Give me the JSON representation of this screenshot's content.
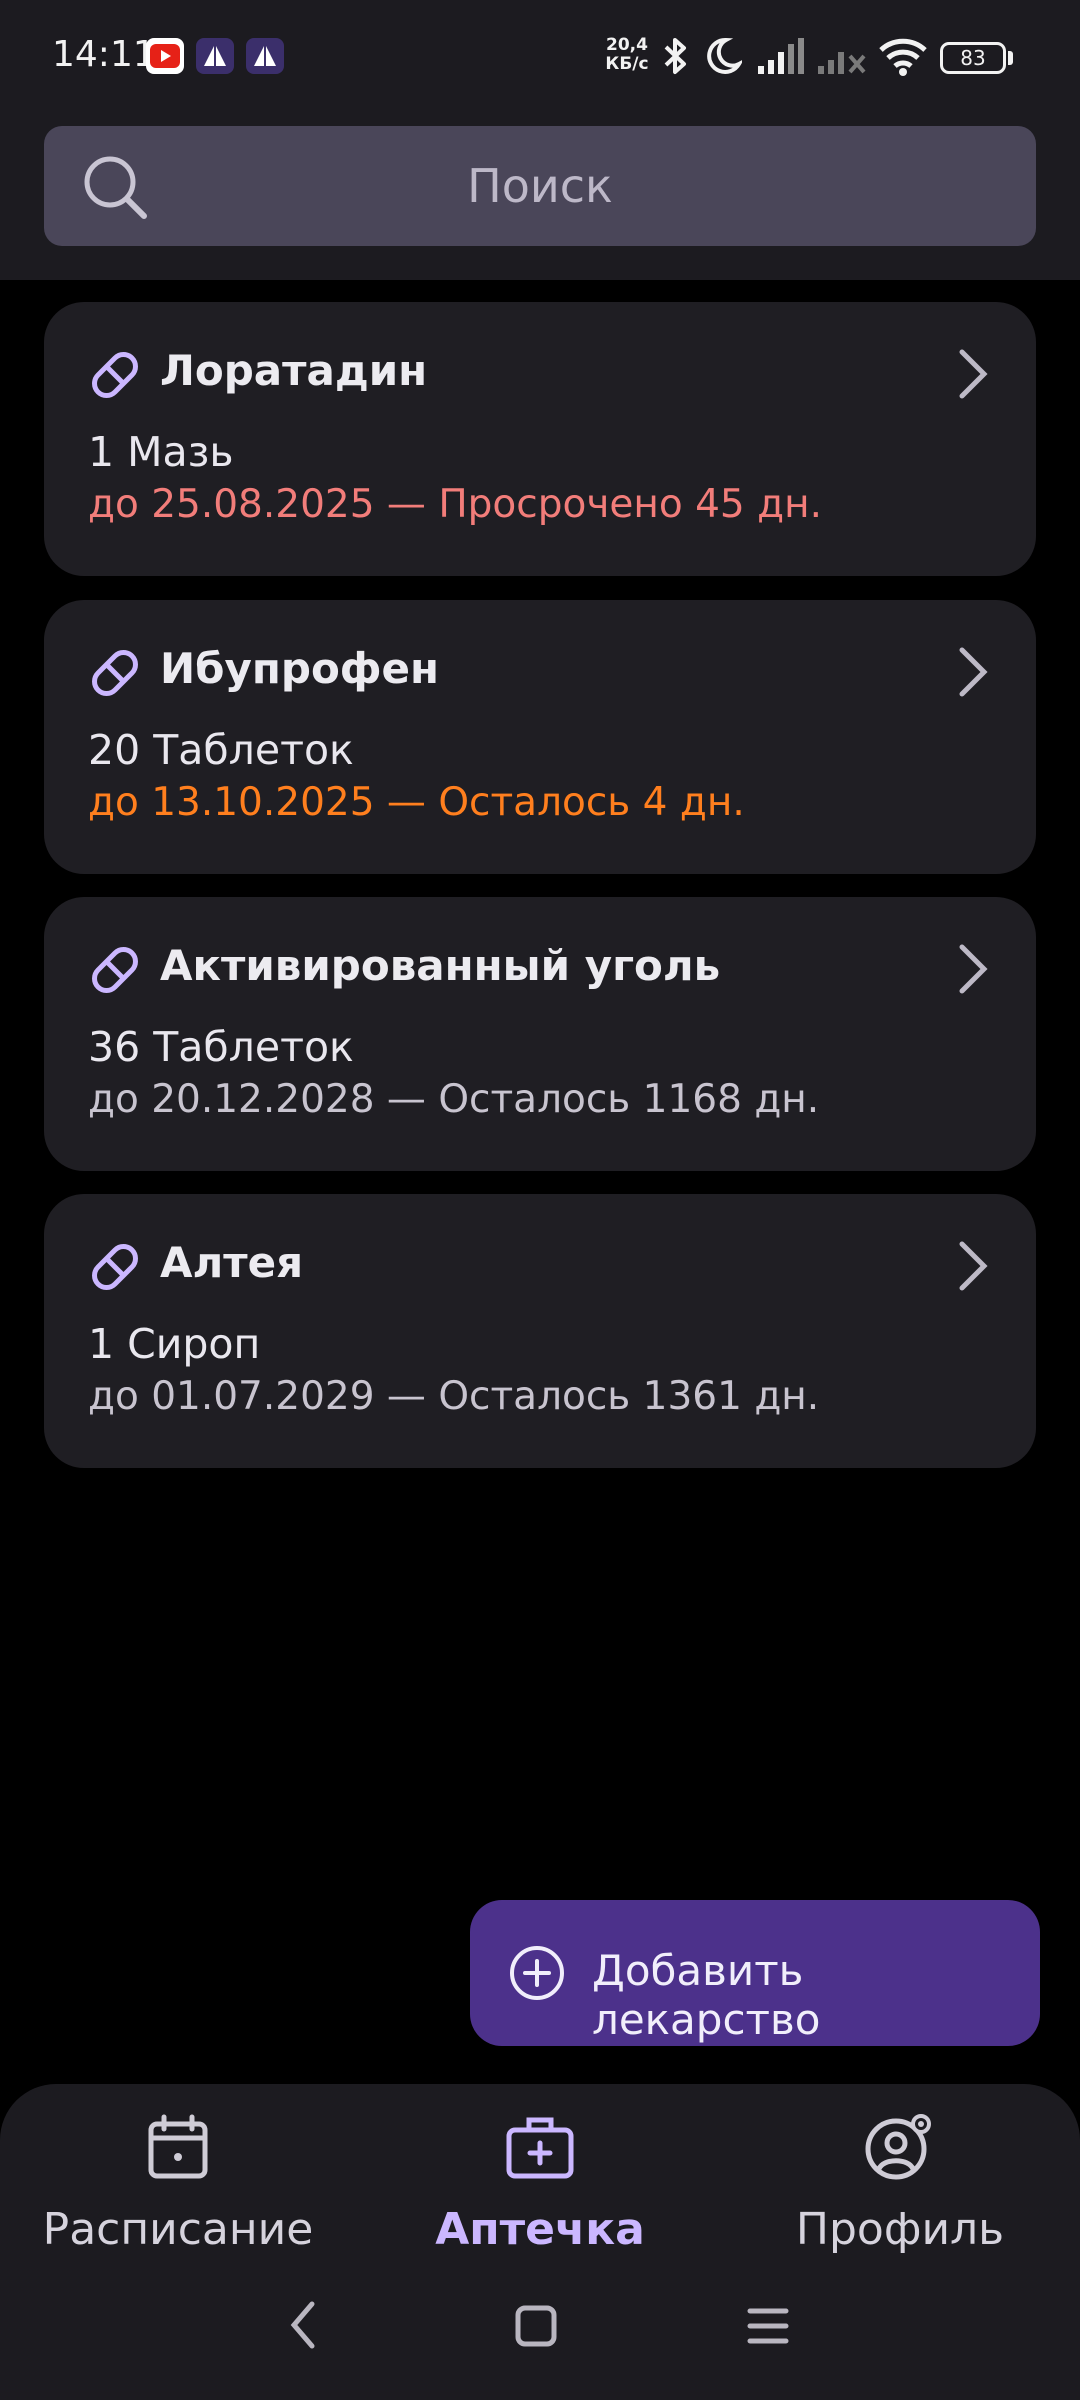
{
  "status_bar": {
    "time": "14:11",
    "net_speed_value": "20,4",
    "net_speed_unit": "КБ/с",
    "battery": "83"
  },
  "search": {
    "placeholder": "Поиск"
  },
  "medicines": [
    {
      "name": "Лоратадин",
      "quantity": "1 Мазь",
      "expiry": "до 25.08.2025 — Просрочено 45 дн.",
      "status": "expired"
    },
    {
      "name": "Ибупрофен",
      "quantity": "20 Таблеток",
      "expiry": "до 13.10.2025 — Осталось 4 дн.",
      "status": "soon"
    },
    {
      "name": "Активированный уголь",
      "quantity": "36 Таблеток",
      "expiry": "до 20.12.2028 — Осталось 1168 дн.",
      "status": "ok"
    },
    {
      "name": "Алтея",
      "quantity": "1 Сироп",
      "expiry": "до 01.07.2029 — Осталось 1361 дн.",
      "status": "ok"
    }
  ],
  "fab": {
    "label": "Добавить лекарство"
  },
  "bottom_nav": {
    "items": [
      {
        "label": "Расписание",
        "icon": "calendar-icon",
        "active": false
      },
      {
        "label": "Аптечка",
        "icon": "medkit-icon",
        "active": true
      },
      {
        "label": "Профиль",
        "icon": "profile-settings-icon",
        "active": false
      }
    ]
  },
  "colors": {
    "accent": "#cbb7ff",
    "fab": "#4c318b",
    "expired": "#f27d7a",
    "soon": "#ff7f1e",
    "card": "#1f1e23",
    "bar": "#1c1b20"
  }
}
